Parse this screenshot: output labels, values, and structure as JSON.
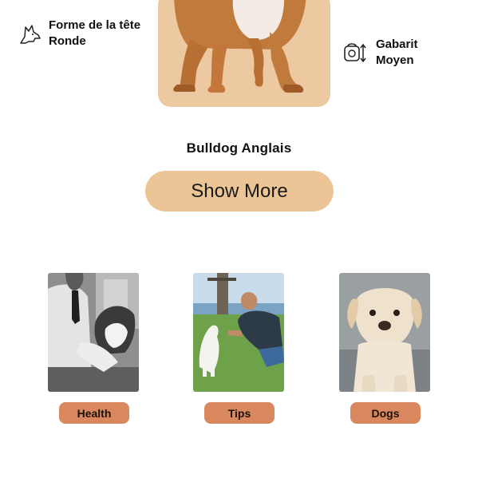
{
  "breed": {
    "name": "Bulldog Anglais",
    "head_shape": {
      "label": "Forme de la tête",
      "value": "Ronde",
      "icon": "dog-head-icon"
    },
    "size": {
      "label": "Gabarit",
      "value": "Moyen",
      "icon": "size-scale-icon"
    },
    "show_more_label": "Show More",
    "card_color": "#ecc9a0"
  },
  "categories": [
    {
      "label": "Health",
      "icon": "health-photo"
    },
    {
      "label": "Tips",
      "icon": "tips-photo"
    },
    {
      "label": "Dogs",
      "icon": "dogs-photo"
    }
  ],
  "colors": {
    "show_more_bg": "#ebc596",
    "category_pill_bg": "#d8875e"
  }
}
